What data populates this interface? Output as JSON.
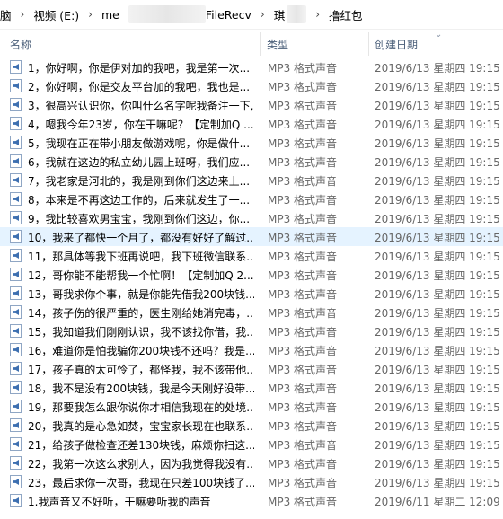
{
  "breadcrumb": {
    "items": [
      "脑",
      "视频 (E:)",
      "me",
      "FileRecv",
      "琪",
      "撸红包"
    ]
  },
  "columns": {
    "name": "名称",
    "type": "类型",
    "date": "创建日期"
  },
  "files": [
    {
      "name": "1，你好啊，你是伊对加的我吧，我是第一次...",
      "type": "MP3 格式声音",
      "date": "2019/6/13 星期四 19:15"
    },
    {
      "name": "2，你好啊，你是交友平台加的我吧，我也是...",
      "type": "MP3 格式声音",
      "date": "2019/6/13 星期四 19:15"
    },
    {
      "name": "3，很高兴认识你，你叫什么名字呢我备注一下,...",
      "type": "MP3 格式声音",
      "date": "2019/6/13 星期四 19:15"
    },
    {
      "name": "4，嗯我今年23岁，你在干嘛呢？【定制加Q ...",
      "type": "MP3 格式声音",
      "date": "2019/6/13 星期四 19:15"
    },
    {
      "name": "5，我现在正在带小朋友做游戏呢，你是做什...",
      "type": "MP3 格式声音",
      "date": "2019/6/13 星期四 19:15"
    },
    {
      "name": "6，我就在这边的私立幼儿园上班呀，我们应...",
      "type": "MP3 格式声音",
      "date": "2019/6/13 星期四 19:15"
    },
    {
      "name": "7，我老家是河北的，我是刚到你们这边来上...",
      "type": "MP3 格式声音",
      "date": "2019/6/13 星期四 19:15"
    },
    {
      "name": "8，本来是不再这边工作的，后来就发生了一...",
      "type": "MP3 格式声音",
      "date": "2019/6/13 星期四 19:15"
    },
    {
      "name": "9，我比较喜欢男宝宝，我刚到你们这边，你...",
      "type": "MP3 格式声音",
      "date": "2019/6/13 星期四 19:15"
    },
    {
      "name": "10，我来了都快一个月了，都没有好好了解过...",
      "type": "MP3 格式声音",
      "date": "2019/6/13 星期四 19:15",
      "selected": true
    },
    {
      "name": "11，那具体等我下班再说吧，我下班微信联系...",
      "type": "MP3 格式声音",
      "date": "2019/6/13 星期四 19:15"
    },
    {
      "name": "12，哥你能不能帮我一个忙啊！【定制加Q 2...",
      "type": "MP3 格式声音",
      "date": "2019/6/13 星期四 19:15"
    },
    {
      "name": "13，哥我求你个事，就是你能先借我200块钱...",
      "type": "MP3 格式声音",
      "date": "2019/6/13 星期四 19:15"
    },
    {
      "name": "14，孩子伤的很严重的，医生刚给她消完毒，...",
      "type": "MP3 格式声音",
      "date": "2019/6/13 星期四 19:15"
    },
    {
      "name": "15，我知道我们刚刚认识，我不该找你借，我...",
      "type": "MP3 格式声音",
      "date": "2019/6/13 星期四 19:15"
    },
    {
      "name": "16，难道你是怕我骗你200块钱不还吗？我是...",
      "type": "MP3 格式声音",
      "date": "2019/6/13 星期四 19:15"
    },
    {
      "name": "17，孩子真的太可怜了，都怪我，我不该带他...",
      "type": "MP3 格式声音",
      "date": "2019/6/13 星期四 19:15"
    },
    {
      "name": "18，我不是没有200块钱，我是今天刚好没带...",
      "type": "MP3 格式声音",
      "date": "2019/6/13 星期四 19:15"
    },
    {
      "name": "19，那要我怎么跟你说你才相信我现在的处境...",
      "type": "MP3 格式声音",
      "date": "2019/6/13 星期四 19:15"
    },
    {
      "name": "20，我真的是心急如焚，宝宝家长现在也联系...",
      "type": "MP3 格式声音",
      "date": "2019/6/13 星期四 19:15"
    },
    {
      "name": "21，给孩子做检查还差130块钱，麻烦你扫这...",
      "type": "MP3 格式声音",
      "date": "2019/6/13 星期四 19:15"
    },
    {
      "name": "22，我第一次这么求别人，因为我觉得我没有...",
      "type": "MP3 格式声音",
      "date": "2019/6/13 星期四 19:15"
    },
    {
      "name": "23，最后求你一次哥，我现在只差100块钱了...",
      "type": "MP3 格式声音",
      "date": "2019/6/13 星期四 19:15"
    },
    {
      "name": "1.我声音又不好听，干嘛要听我的声音",
      "type": "MP3 格式声音",
      "date": "2019/6/11 星期二 12:09"
    }
  ]
}
